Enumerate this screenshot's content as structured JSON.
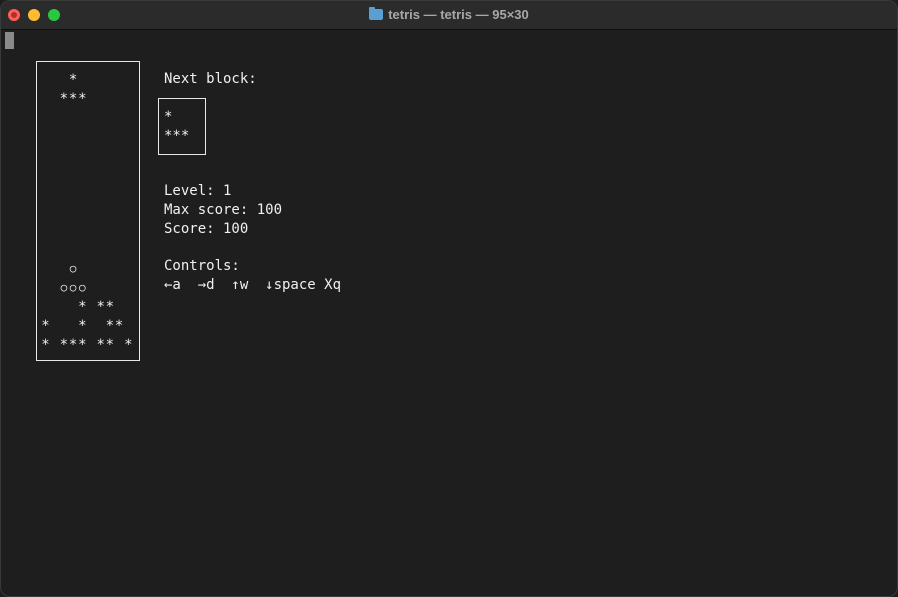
{
  "window": {
    "title": "tetris — tetris — 95×30"
  },
  "board": {
    "rows": 15,
    "cols": 11,
    "cells": [
      {
        "row": 0,
        "col": 3,
        "char": "*"
      },
      {
        "row": 1,
        "col": 2,
        "char": "*"
      },
      {
        "row": 1,
        "col": 3,
        "char": "*"
      },
      {
        "row": 1,
        "col": 4,
        "char": "*"
      },
      {
        "row": 10,
        "col": 3,
        "char": "○"
      },
      {
        "row": 11,
        "col": 2,
        "char": "○"
      },
      {
        "row": 11,
        "col": 3,
        "char": "○"
      },
      {
        "row": 11,
        "col": 4,
        "char": "○"
      },
      {
        "row": 12,
        "col": 4,
        "char": "*"
      },
      {
        "row": 12,
        "col": 6,
        "char": "*"
      },
      {
        "row": 12,
        "col": 7,
        "char": "*"
      },
      {
        "row": 13,
        "col": 0,
        "char": "*"
      },
      {
        "row": 13,
        "col": 4,
        "char": "*"
      },
      {
        "row": 13,
        "col": 7,
        "char": "*"
      },
      {
        "row": 13,
        "col": 8,
        "char": "*"
      },
      {
        "row": 14,
        "col": 0,
        "char": "*"
      },
      {
        "row": 14,
        "col": 2,
        "char": "*"
      },
      {
        "row": 14,
        "col": 3,
        "char": "*"
      },
      {
        "row": 14,
        "col": 4,
        "char": "*"
      },
      {
        "row": 14,
        "col": 6,
        "char": "*"
      },
      {
        "row": 14,
        "col": 7,
        "char": "*"
      },
      {
        "row": 14,
        "col": 9,
        "char": "*"
      }
    ]
  },
  "next_block": {
    "label": "Next block:",
    "line1": "*",
    "line2": "***"
  },
  "stats": {
    "level": "Level: 1",
    "max_score": "Max score: 100",
    "score": "Score: 100"
  },
  "controls": {
    "label": "Controls:",
    "keys": "←a  →d  ↑w  ↓space Xq"
  }
}
